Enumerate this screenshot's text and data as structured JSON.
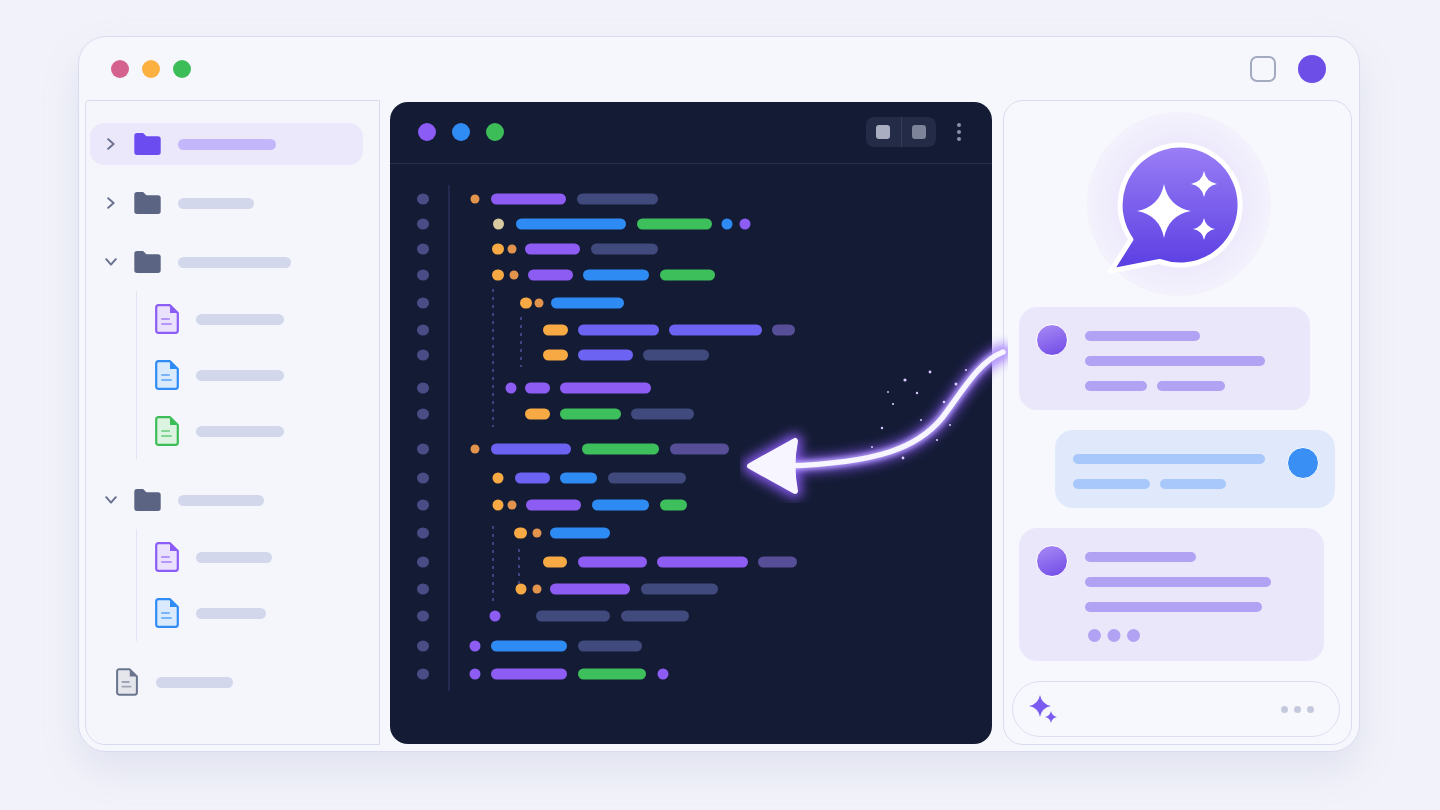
{
  "window": {
    "controls": [
      {
        "color": "#d3638e"
      },
      {
        "color": "#fbb040"
      },
      {
        "color": "#3dbd58"
      }
    ]
  },
  "sidebar": {
    "items": [
      {
        "kind": "folder",
        "selected": true,
        "expanded": false
      },
      {
        "kind": "folder",
        "selected": false,
        "expanded": false
      },
      {
        "kind": "folder",
        "selected": false,
        "expanded": true,
        "children": [
          {
            "kind": "file",
            "selected": false,
            "color": "#8b5cf6"
          },
          {
            "kind": "file",
            "selected": false,
            "color": "#2f8cf5"
          },
          {
            "kind": "file",
            "selected": false,
            "color": "#3dbd58"
          }
        ]
      },
      {
        "kind": "folder",
        "selected": false,
        "expanded": true,
        "children": [
          {
            "kind": "file",
            "selected": false,
            "color": "#8b5cf6"
          },
          {
            "kind": "file",
            "selected": false,
            "color": "#2f8cf5"
          }
        ]
      },
      {
        "kind": "file",
        "selected": false,
        "color": "#6b7590"
      }
    ]
  },
  "editor": {
    "dots": [
      {
        "color": "#8b5cf6"
      },
      {
        "color": "#2f8cf5"
      },
      {
        "color": "#3dbd58"
      }
    ]
  },
  "chat": {
    "messages": [
      {
        "kind": "assistant",
        "typing": false
      },
      {
        "kind": "user",
        "typing": false
      },
      {
        "kind": "assistant",
        "typing": true
      }
    ]
  }
}
